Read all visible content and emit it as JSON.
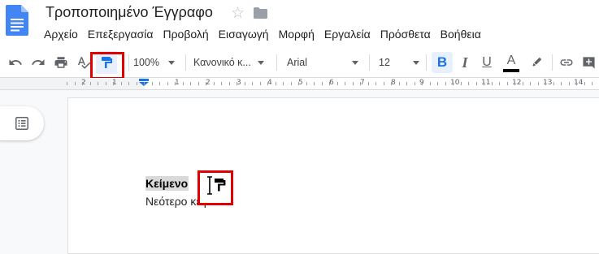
{
  "document": {
    "title": "Τροποποιημένο Έγγραφο",
    "line1": "Κείμενο",
    "line2": "Νεότερο κείμενο"
  },
  "menu": [
    "Αρχείο",
    "Επεξεργασία",
    "Προβολή",
    "Εισαγωγή",
    "Μορφή",
    "Εργαλεία",
    "Πρόσθετα",
    "Βοήθεια"
  ],
  "toolbar": {
    "zoom": "100%",
    "style": "Κανονικό κ...",
    "font": "Arial",
    "font_size": "12"
  },
  "ruler": {
    "numbers": [
      "2",
      "1",
      "1",
      "2",
      "3",
      "4",
      "5",
      "6",
      "7",
      "8",
      "9",
      "10",
      "11",
      "12",
      "13",
      "14"
    ]
  },
  "colors": {
    "accent": "#1a73e8",
    "highlight_box": "#e00000",
    "active_button_bg": "#e8f0fe"
  }
}
